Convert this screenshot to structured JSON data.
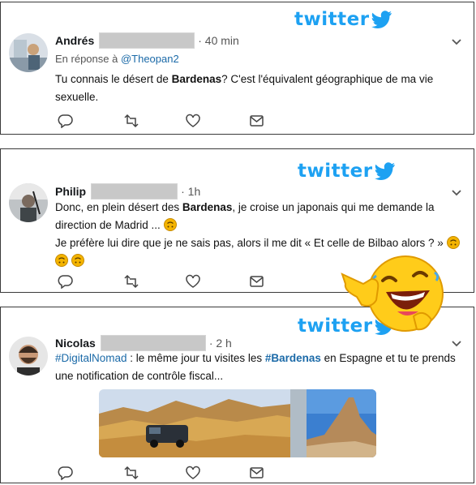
{
  "colors": {
    "twitter_blue": "#1da1f2",
    "link": "#1b6aa8",
    "border": "#3a3a3a",
    "blur": "#c8c8c8"
  },
  "tweet1": {
    "logo": "twitter",
    "author": "Andrés",
    "time": "· 40 min",
    "reply_prefix": "En réponse à ",
    "reply_handle": "@Theopan2",
    "text_a": "Tu connais le désert de ",
    "text_b": "Bardenas",
    "text_c": "? C'est l'équivalent géographique de ma vie",
    "text_d": "sexuelle."
  },
  "tweet2": {
    "logo": "twitter",
    "author": "Philip",
    "time": "· 1h",
    "line1_a": "Donc, en plein désert des ",
    "line1_b": "Bardenas",
    "line1_c": ", je croise un japonais qui me demande la",
    "line2": "direction de Madrid ...",
    "line3": "Je préfère lui dire que je ne sais pas, alors il me dit « Et celle de Bilbao alors ? »"
  },
  "tweet3": {
    "logo": "twitter",
    "author": "Nicolas",
    "time": "· 2 h",
    "hashtag1": "#DigitalNomad",
    "line1_a": " : le même jour tu visites les ",
    "hashtag2": "#Bardenas",
    "line1_b": " en Espagne et tu te prends",
    "line2": "une notification de contrôle fiscal..."
  },
  "icons": [
    "reply-icon",
    "retweet-icon",
    "like-icon",
    "message-icon",
    "chevron-down-icon",
    "twitter-bird-icon",
    "laughing-emoji"
  ]
}
